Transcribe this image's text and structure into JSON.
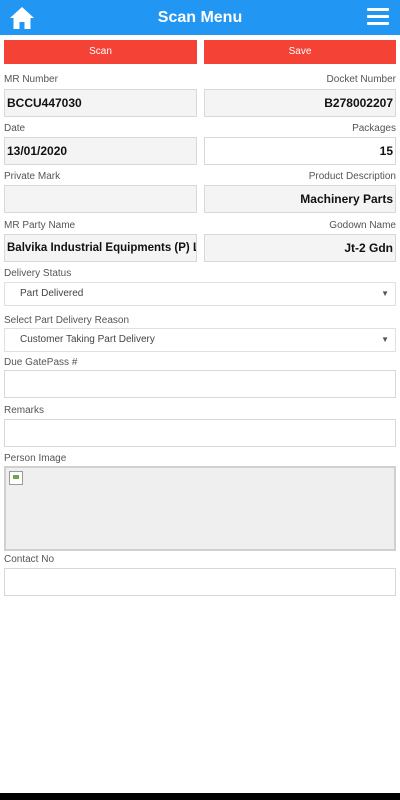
{
  "header": {
    "title": "Scan Menu",
    "home_icon": "home-icon",
    "menu_icon": "hamburger-menu-icon",
    "color": "#2196f3"
  },
  "actions": {
    "scan_label": "Scan",
    "save_label": "Save",
    "color": "#f44336"
  },
  "form": {
    "mr_number": {
      "label": "MR Number",
      "value": "BCCU447030"
    },
    "docket_number": {
      "label": "Docket Number",
      "value": "B278002207"
    },
    "date": {
      "label": "Date",
      "value": "13/01/2020"
    },
    "packages": {
      "label": "Packages",
      "value": "15"
    },
    "private_mark": {
      "label": "Private Mark",
      "value": ""
    },
    "product_description": {
      "label": "Product Description",
      "value": "Machinery Parts"
    },
    "mr_party_name": {
      "label": "MR Party Name",
      "value": "Balvika Industrial Equipments (P) Ltd"
    },
    "godown_name": {
      "label": "Godown Name",
      "value": "Jt-2 Gdn"
    },
    "delivery_status": {
      "label": "Delivery Status",
      "selected": "Part Delivered"
    },
    "part_delivery_reason": {
      "label": "Select Part Delivery Reason",
      "selected": "Customer Taking Part Delivery"
    },
    "due_gatepass": {
      "label": "Due GatePass #",
      "value": ""
    },
    "remarks": {
      "label": "Remarks",
      "value": ""
    },
    "person_image": {
      "label": "Person Image"
    },
    "contact_no": {
      "label": "Contact No",
      "value": ""
    }
  }
}
